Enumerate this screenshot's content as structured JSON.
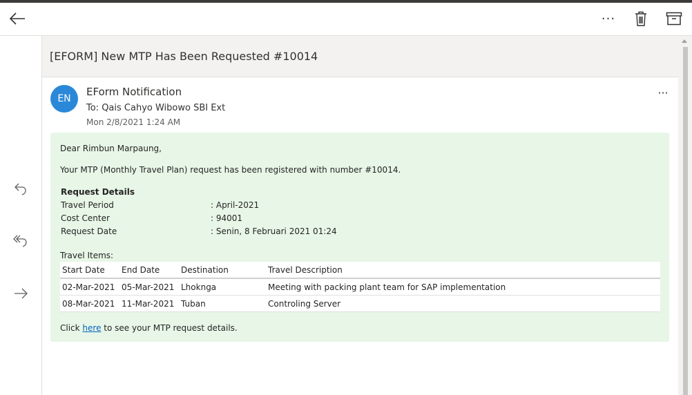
{
  "toolbar": {
    "back_icon": "arrow-left-icon",
    "more_label": "···",
    "delete_icon": "trash-icon",
    "archive_icon": "archive-icon"
  },
  "rail": {
    "reply_icon": "reply-icon",
    "reply_all_icon": "reply-all-icon",
    "forward_icon": "forward-icon"
  },
  "email": {
    "subject": "[EFORM] New MTP Has Been Requested #10014",
    "avatar_initials": "EN",
    "avatar_color": "#2b88d8",
    "sender": "EForm Notification",
    "to": "To: Qais Cahyo Wibowo SBI Ext",
    "date": "Mon 2/8/2021 1:24 AM",
    "more_label": "···"
  },
  "body": {
    "background": "#e7f6e6",
    "greeting": "Dear Rimbun Marpaung,",
    "intro": "Your MTP (Monthly Travel Plan) request has been registered with number #10014.",
    "request_details_title": "Request Details",
    "details": [
      {
        "label": "Travel Period",
        "value": ": April-2021"
      },
      {
        "label": "Cost Center",
        "value": ": 94001"
      },
      {
        "label": "Request Date",
        "value": ": Senin, 8 Februari 2021 01:24"
      }
    ],
    "travel_items_title": "Travel Items:",
    "columns": [
      "Start Date",
      "End Date",
      "Destination",
      "Travel Description"
    ],
    "rows": [
      [
        "02-Mar-2021",
        "05-Mar-2021",
        "Lhoknga",
        "Meeting with packing plant team for SAP implementation"
      ],
      [
        "08-Mar-2021",
        "11-Mar-2021",
        "Tuban",
        "Controling Server"
      ]
    ],
    "footer_prefix": "Click ",
    "footer_link": "here",
    "footer_suffix": " to see your MTP request details."
  }
}
